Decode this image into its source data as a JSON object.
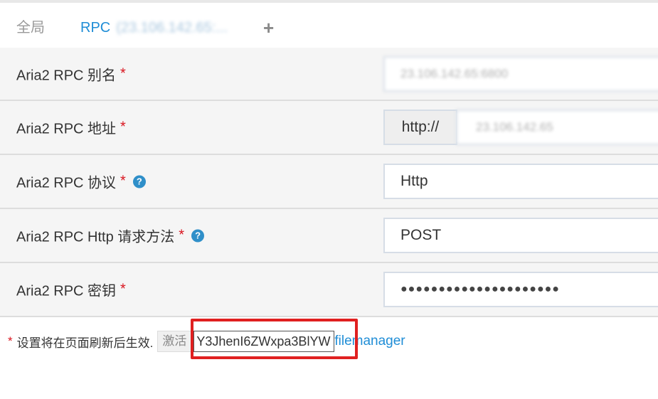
{
  "tabs": {
    "global_label": "全局",
    "rpc_label": "RPC",
    "rpc_host_masked": "(23.106.142.65:...",
    "add_label": "+"
  },
  "form": {
    "alias": {
      "label": "Aria2 RPC 别名",
      "required": "*",
      "value": "23.106.142.65:6800"
    },
    "address": {
      "label": "Aria2 RPC 地址",
      "required": "*",
      "prefix": "http://",
      "value": "23.106.142.65"
    },
    "protocol": {
      "label": "Aria2 RPC 协议",
      "required": "*",
      "help": "?",
      "value": "Http"
    },
    "method": {
      "label": "Aria2 RPC Http 请求方法",
      "required": "*",
      "help": "?",
      "value": "POST"
    },
    "secret": {
      "label": "Aria2 RPC 密钥",
      "required": "*",
      "value": "●●●●●●●●●●●●●●●●●●●●●"
    }
  },
  "footer": {
    "required": "*",
    "note": "设置将在页面刷新后生效.",
    "activate_label": "激活",
    "key_value": "Y3JhenI6ZWxpa3BlYW",
    "link_text": "filemanager"
  },
  "colors": {
    "accent": "#1f8dd6",
    "required": "#d9141e",
    "highlight": "#e02020"
  }
}
